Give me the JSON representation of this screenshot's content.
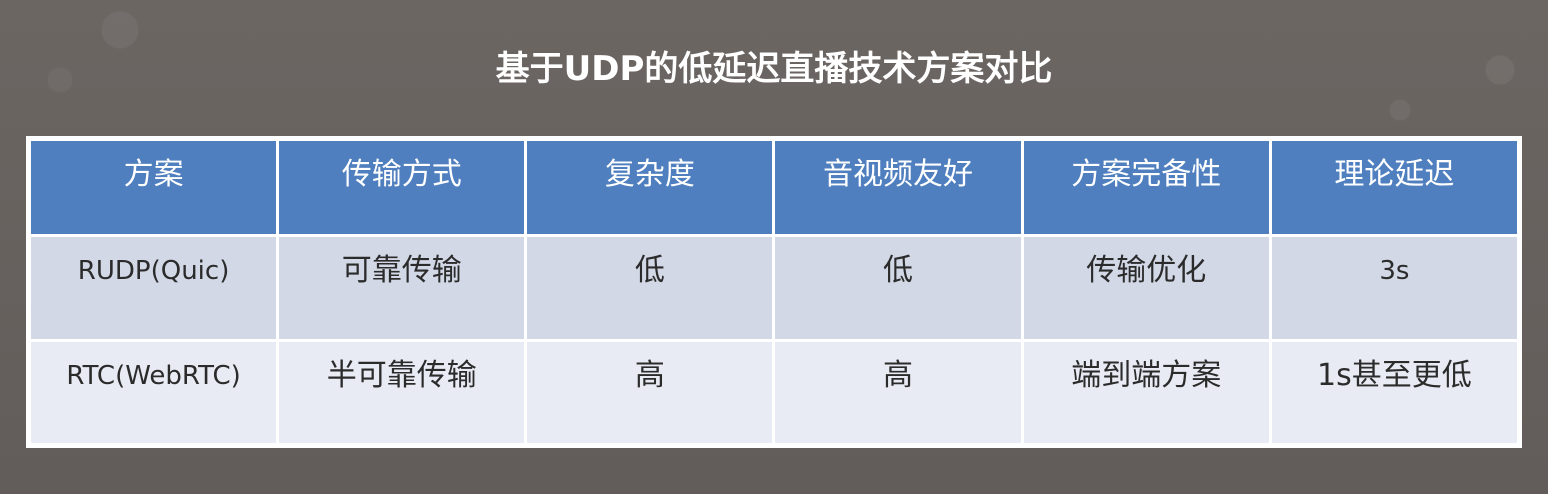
{
  "title": "基于UDP的低延迟直播技术方案对比",
  "table": {
    "headers": [
      "方案",
      "传输方式",
      "复杂度",
      "音视频友好",
      "方案完备性",
      "理论延迟"
    ],
    "rows": [
      [
        "RUDP(Quic)",
        "可靠传输",
        "低",
        "低",
        "传输优化",
        "3s"
      ],
      [
        "RTC(WebRTC)",
        "半可靠传输",
        "高",
        "高",
        "端到端方案",
        "1s甚至更低"
      ]
    ]
  },
  "colors": {
    "background": "#686260",
    "header": "#4f7fbf",
    "row_a": "#d2d8e6",
    "row_b": "#e8ebf3"
  }
}
